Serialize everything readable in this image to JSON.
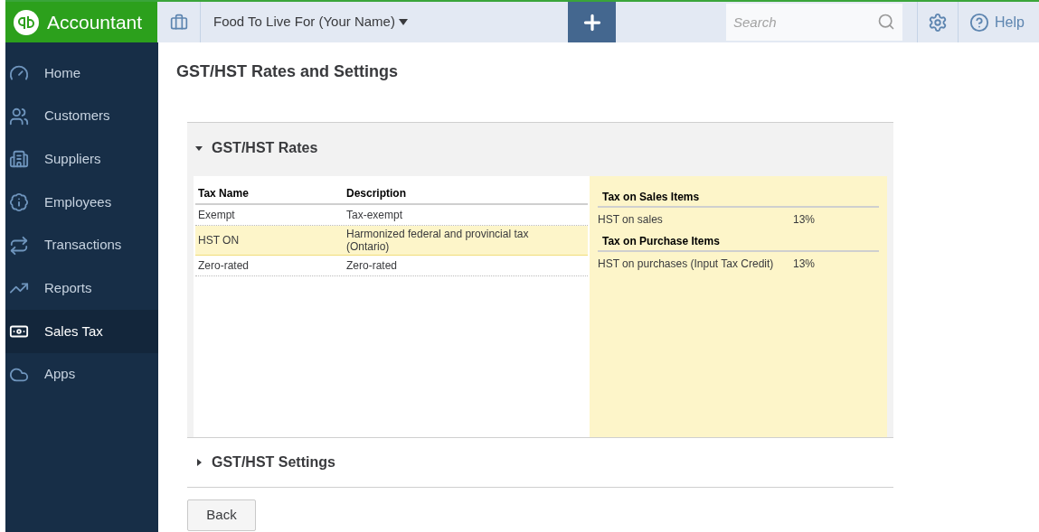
{
  "brand": {
    "name": "Accountant"
  },
  "topbar": {
    "company": "Food To Live For (Your Name)",
    "search": {
      "placeholder": "Search"
    },
    "help": "Help"
  },
  "sidebar": {
    "items": [
      {
        "label": "Home",
        "selected": false
      },
      {
        "label": "Customers",
        "selected": false
      },
      {
        "label": "Suppliers",
        "selected": false
      },
      {
        "label": "Employees",
        "selected": false
      },
      {
        "label": "Transactions",
        "selected": false
      },
      {
        "label": "Reports",
        "selected": false
      },
      {
        "label": "Sales Tax",
        "selected": true
      },
      {
        "label": "Apps",
        "selected": false
      }
    ]
  },
  "page": {
    "title": "GST/HST Rates and Settings"
  },
  "rates_section": {
    "title": "GST/HST Rates",
    "expanded": true,
    "table": {
      "columns": [
        "Tax Name",
        "Description"
      ],
      "rows": [
        {
          "cells": [
            "Exempt",
            "Tax-exempt"
          ],
          "selected": false
        },
        {
          "cells": [
            "HST ON",
            "Harmonized federal and provincial tax (Ontario)"
          ],
          "selected": true
        },
        {
          "cells": [
            "Zero-rated",
            "Zero-rated"
          ],
          "selected": false
        }
      ]
    },
    "details": [
      {
        "heading": "Tax on Sales Items",
        "rows": [
          {
            "name": "HST on sales",
            "rate": "13%"
          }
        ]
      },
      {
        "heading": "Tax on Purchase Items",
        "rows": [
          {
            "name": "HST on purchases (Input Tax Credit)",
            "rate": "13%"
          }
        ]
      }
    ]
  },
  "settings_section": {
    "title": "GST/HST Settings",
    "expanded": false
  },
  "buttons": [
    "Back"
  ]
}
